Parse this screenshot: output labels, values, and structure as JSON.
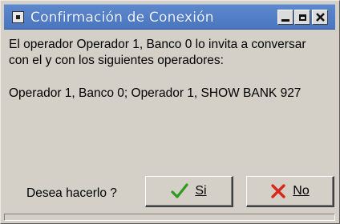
{
  "window": {
    "title": "Confirmación de Conexión",
    "controls": {
      "minimize_icon": "minimize-icon",
      "maximize_icon": "maximize-icon",
      "close_icon": "close-icon"
    }
  },
  "message": {
    "line1": "El operador Operador 1, Banco 0  lo invita a conversar",
    "line2": "con el y con los siguientes operadores:"
  },
  "operators": "Operador 1, Banco 0; Operador 1, SHOW BANK 927",
  "question": "Desea hacerlo ?",
  "buttons": {
    "yes_label": "Si",
    "no_label": "No",
    "yes_icon": "checkmark-icon",
    "no_icon": "x-icon"
  },
  "colors": {
    "titlebar": "#4a76bf",
    "dialog_bg": "#d4d0c8",
    "check_green": "#2e9a1e",
    "x_red": "#d8281c"
  }
}
